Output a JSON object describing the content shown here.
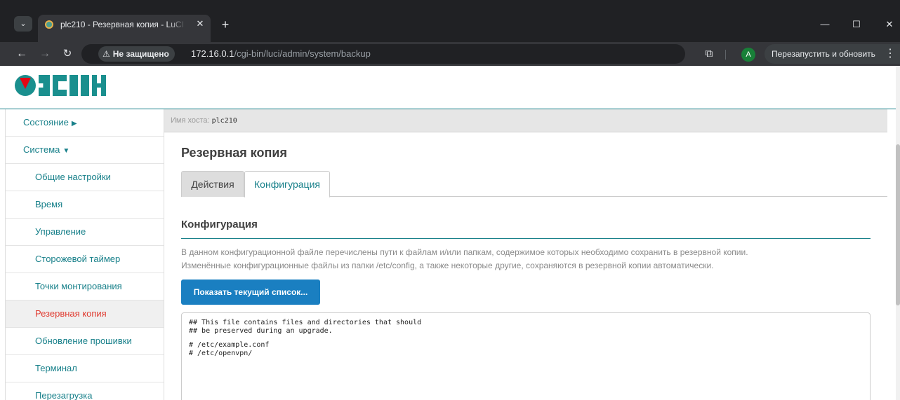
{
  "browser": {
    "tab_title": "plc210 - Резервная копия - LuCI",
    "tab_close": "✕",
    "new_tab": "+",
    "security_label": "Не защищено",
    "url_host": "172.16.0.1",
    "url_path": "/cgi-bin/luci/admin/system/backup",
    "profile_initial": "A",
    "relaunch_label": "Перезапустить и обновить"
  },
  "header": {
    "logo_text": "ОВЕН"
  },
  "sidebar": {
    "items": [
      {
        "label": "Состояние",
        "caret": "▶"
      },
      {
        "label": "Система",
        "caret": "▼"
      },
      {
        "label": "Общие настройки"
      },
      {
        "label": "Время"
      },
      {
        "label": "Управление"
      },
      {
        "label": "Сторожевой таймер"
      },
      {
        "label": "Точки монтирования"
      },
      {
        "label": "Резервная копия"
      },
      {
        "label": "Обновление прошивки"
      },
      {
        "label": "Терминал"
      },
      {
        "label": "Перезагрузка"
      }
    ]
  },
  "content": {
    "hostname_label": "Имя хоста:",
    "hostname_value": "plc210",
    "page_title": "Резервная копия",
    "tabs": [
      {
        "label": "Действия",
        "active": false
      },
      {
        "label": "Конфигурация",
        "active": true
      }
    ],
    "section_title": "Конфигурация",
    "description_line1": "В данном конфигурационной файле перечислены пути к файлам и/или папкам, содержимое которых необходимо сохранить в резервной копии.",
    "description_line2": "Изменённые конфигурационные файлы из папки /etc/config, а также некоторые другие, сохраняются в резервной копии автоматически.",
    "show_list_button": "Показать текущий список...",
    "editor_lines": [
      "## This file contains files and directories that should",
      "## be preserved during an upgrade.",
      "",
      "# /etc/example.conf",
      "# /etc/openvpn/"
    ]
  },
  "colors": {
    "accent": "#18808a",
    "active_nav": "#e03c31",
    "button": "#1a7fc1",
    "logo_red": "#e30613"
  }
}
